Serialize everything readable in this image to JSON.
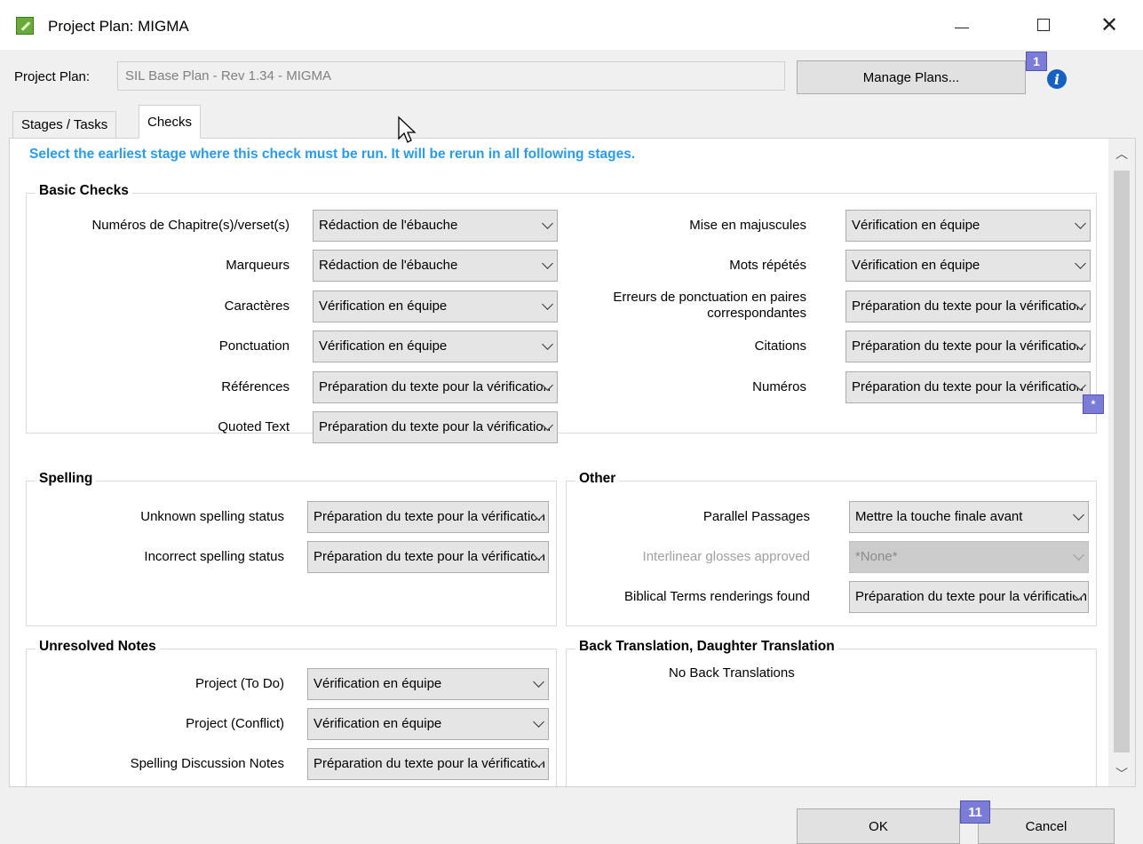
{
  "window": {
    "title": "Project Plan: MIGMA",
    "minimize": "—",
    "maximize": "☐",
    "close": "✕"
  },
  "plan": {
    "label": "Project Plan:",
    "value": "SIL Base Plan - Rev 1.34 - MIGMA",
    "manage_label": "Manage Plans...",
    "badge": "1",
    "info_icon": "info-icon"
  },
  "tabs": [
    "Stages / Tasks",
    "Checks"
  ],
  "instructions": "Select the earliest stage where this check must be run. It will be rerun in all following stages.",
  "basic": {
    "title": "Basic Checks",
    "left": [
      {
        "label": "Numéros de Chapitre(s)/verset(s)",
        "value": "Rédaction de l'ébauche"
      },
      {
        "label": "Marqueurs",
        "value": "Rédaction de l'ébauche"
      },
      {
        "label": "Caractères",
        "value": "Vérification en équipe"
      },
      {
        "label": "Ponctuation",
        "value": "Vérification en équipe"
      },
      {
        "label": "Références",
        "value": "Préparation du texte pour la vérification"
      },
      {
        "label": "Quoted Text",
        "value": "Préparation du texte pour la vérification"
      }
    ],
    "right": [
      {
        "label": "Mise en majuscules",
        "value": "Vérification en équipe"
      },
      {
        "label": "Mots répétés",
        "value": "Vérification en équipe"
      },
      {
        "label": "Erreurs de ponctuation en paires correspondantes",
        "value": "Préparation du texte pour la vérification"
      },
      {
        "label": "Citations",
        "value": "Préparation du texte pour la vérification"
      },
      {
        "label": "Numéros",
        "value": "Préparation du texte pour la vérification"
      }
    ]
  },
  "spelling": {
    "title": "Spelling",
    "rows": [
      {
        "label": "Unknown spelling status",
        "value": "Préparation du texte pour la vérification"
      },
      {
        "label": "Incorrect spelling status",
        "value": "Préparation du texte pour la vérification"
      }
    ]
  },
  "other": {
    "title": "Other",
    "rows": [
      {
        "label": "Parallel Passages",
        "value": "Mettre la touche finale avant"
      },
      {
        "label": "Interlinear glosses approved",
        "value": "*None*"
      },
      {
        "label": "Biblical Terms renderings found",
        "value": "Préparation du texte pour la vérification"
      }
    ],
    "badge": "*"
  },
  "notes": {
    "title": "Unresolved Notes",
    "rows": [
      {
        "label": "Project (To Do)",
        "value": "Vérification en équipe"
      },
      {
        "label": "Project (Conflict)",
        "value": "Vérification en équipe"
      },
      {
        "label": "Spelling Discussion Notes",
        "value": "Préparation du texte pour la vérification"
      }
    ]
  },
  "backtranslation": {
    "title": "Back Translation, Daughter Translation",
    "text": "No Back Translations"
  },
  "buttons": {
    "ok": "OK",
    "cancel": "Cancel",
    "badge": "11"
  }
}
